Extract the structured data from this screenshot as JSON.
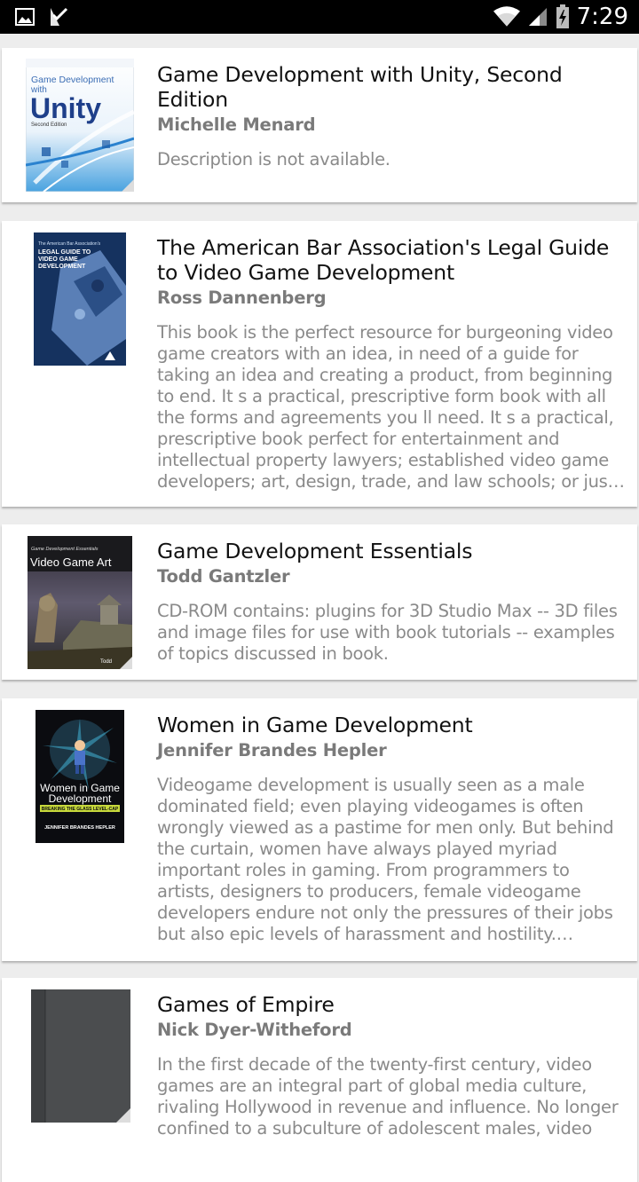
{
  "status_bar": {
    "time": "7:29",
    "left_icons": [
      "image-icon",
      "check-download-icon"
    ],
    "right_icons": [
      "wifi-icon",
      "signal-icon",
      "battery-charging-icon"
    ]
  },
  "books": [
    {
      "title": "Game Development with Unity, Second Edition",
      "author": "Michelle Menard",
      "description": "Description is not available.",
      "cover_icon": "book-cover-unity"
    },
    {
      "title": "The American Bar Association's Legal Guide to Video Game Development",
      "author": "Ross Dannenberg",
      "description": "This book is the perfect resource for burgeoning video game creators with an idea, in need of a guide for taking an idea and creating a product, from beginning to end. It s a practical, prescriptive form book with all the forms and agreements you ll need. It s a practical, prescriptive book perfect for entertainment and intellectual property lawyers; established video game developers; art, design, trade, and law schools; or just burgeoning artists with…",
      "cover_icon": "book-cover-legal-guide"
    },
    {
      "title": "Game Development Essentials",
      "author": "Todd Gantzler",
      "description": "CD-ROM contains: plugins for 3D Studio Max -- 3D files and image files for use with book tutorials -- examples of topics discussed in book.",
      "cover_icon": "book-cover-video-game-art"
    },
    {
      "title": "Women in Game Development",
      "author": "Jennifer Brandes Hepler",
      "description": "Videogame development is usually seen as a male dominated field; even playing videogames is often wrongly viewed as a pastime for men only. But behind the curtain, women have always played myriad important roles in gaming. From programmers to artists, designers to producers, female videogame developers endure not only the pressures of their jobs but also epic levels of harassment and hostility. Jennifer Brandes…",
      "cover_icon": "book-cover-women-in-game-dev"
    },
    {
      "title": "Games of Empire",
      "author": "Nick Dyer-Witheford",
      "description": "In the first decade of the twenty-first century, video games are an integral part of global media culture, rivaling Hollywood in revenue and influence. No longer confined to a subculture of adolescent males, video",
      "cover_icon": "book-cover-games-of-empire"
    }
  ],
  "covers": {
    "unity": {
      "line1": "Game Development",
      "line2": "with",
      "line3": "Unity",
      "line4": "Second Edition"
    },
    "legal": {
      "line1": "The American Bar Association's",
      "line2": "LEGAL GUIDE TO",
      "line3": "VIDEO GAME",
      "line4": "DEVELOPMENT"
    },
    "vga": {
      "line1": "Game Development Essentials",
      "line2": "Video Game Art",
      "line3": "Todd"
    },
    "women": {
      "line1": "Game Development",
      "line2": "Women in Game",
      "line3": "Development",
      "line4": "BREAKING THE GLASS LEVEL-CAP",
      "line5": "JENNIFER BRANDES HEPLER"
    }
  }
}
